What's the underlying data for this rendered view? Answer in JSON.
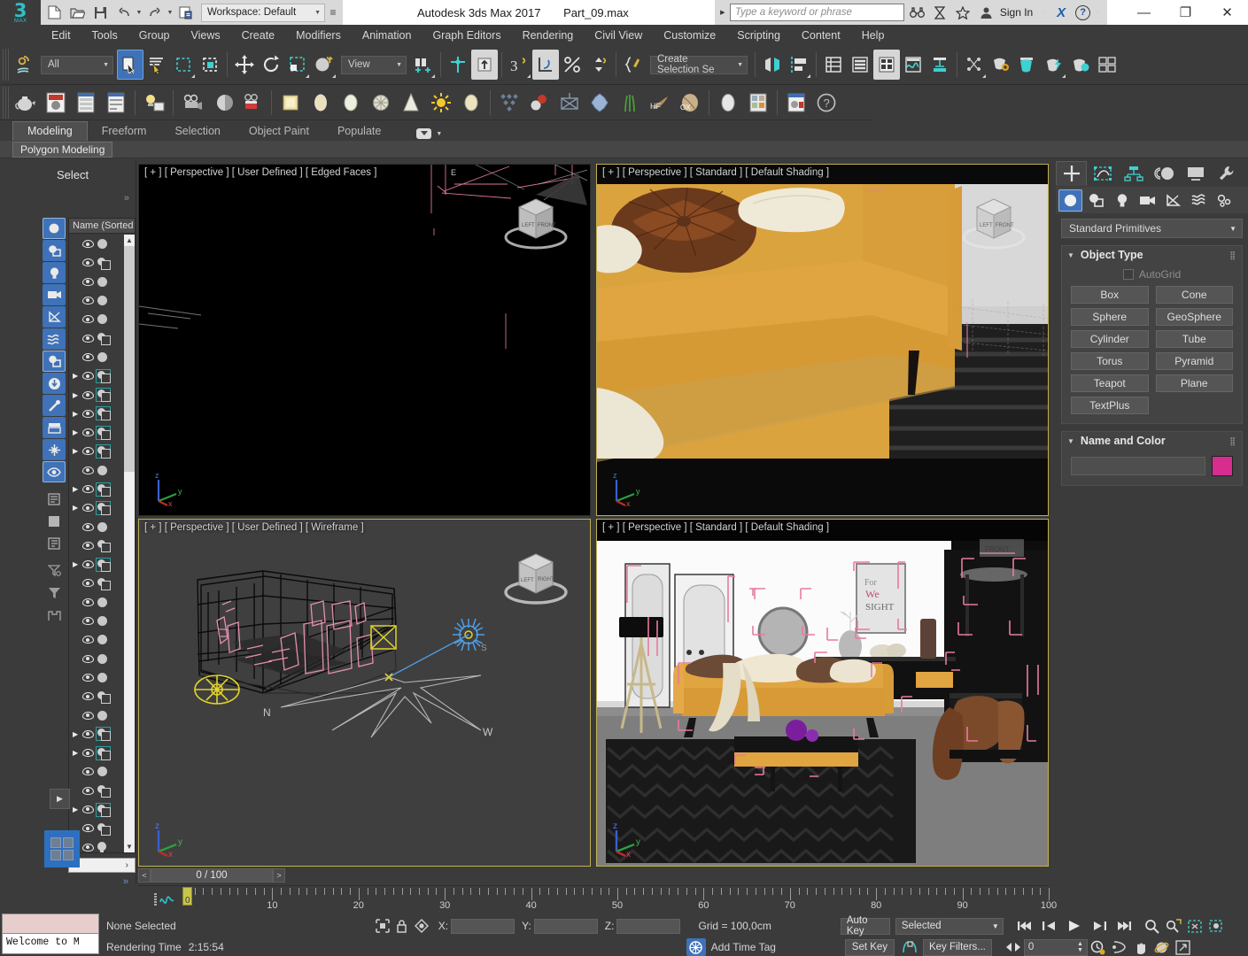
{
  "titlebar": {
    "workspace": "Workspace: Default",
    "app_title": "Autodesk 3ds Max 2017",
    "file_name": "Part_09.max",
    "search_placeholder": "Type a keyword or phrase",
    "sign_in": "Sign In",
    "x_logo": "X",
    "help_glyph": "?",
    "minimize": "—",
    "maximize": "❐",
    "close": "✕",
    "logo_number": "3",
    "logo_sub": "MAX"
  },
  "menubar": {
    "items": [
      "Edit",
      "Tools",
      "Group",
      "Views",
      "Create",
      "Modifiers",
      "Animation",
      "Graph Editors",
      "Rendering",
      "Civil View",
      "Customize",
      "Scripting",
      "Content",
      "Help"
    ]
  },
  "toolbar": {
    "filter_value": "All",
    "reference_coord": "View",
    "selection_set": "Create Selection Se"
  },
  "ribbon": {
    "tabs": [
      "Modeling",
      "Freeform",
      "Selection",
      "Object Paint",
      "Populate"
    ],
    "active_tab": "Modeling",
    "panel_label": "Polygon Modeling"
  },
  "explorer": {
    "title": "Select",
    "column_header": "Name (Sorted",
    "expand_chevron": "»",
    "prev": "‹",
    "next": "›",
    "rows": [
      {
        "tri": false,
        "icon": "dot"
      },
      {
        "tri": false,
        "icon": "geo"
      },
      {
        "tri": false,
        "icon": "dot"
      },
      {
        "tri": false,
        "icon": "dot"
      },
      {
        "tri": false,
        "icon": "dot"
      },
      {
        "tri": false,
        "icon": "geo"
      },
      {
        "tri": false,
        "icon": "dot"
      },
      {
        "tri": true,
        "icon": "geo-sel"
      },
      {
        "tri": true,
        "icon": "geo-sel"
      },
      {
        "tri": true,
        "icon": "geo-sel"
      },
      {
        "tri": true,
        "icon": "geo-sel"
      },
      {
        "tri": true,
        "icon": "geo-sel"
      },
      {
        "tri": false,
        "icon": "dot"
      },
      {
        "tri": true,
        "icon": "geo-sel"
      },
      {
        "tri": true,
        "icon": "geo-sel"
      },
      {
        "tri": false,
        "icon": "dot"
      },
      {
        "tri": false,
        "icon": "geo"
      },
      {
        "tri": true,
        "icon": "geo-sel"
      },
      {
        "tri": false,
        "icon": "geo"
      },
      {
        "tri": false,
        "icon": "dot"
      },
      {
        "tri": false,
        "icon": "dot"
      },
      {
        "tri": false,
        "icon": "dot"
      },
      {
        "tri": false,
        "icon": "dot"
      },
      {
        "tri": false,
        "icon": "dot"
      },
      {
        "tri": false,
        "icon": "geo"
      },
      {
        "tri": false,
        "icon": "dot"
      },
      {
        "tri": true,
        "icon": "geo-sel"
      },
      {
        "tri": true,
        "icon": "geo-sel"
      },
      {
        "tri": false,
        "icon": "dot"
      },
      {
        "tri": false,
        "icon": "geo"
      },
      {
        "tri": true,
        "icon": "geo-sel"
      },
      {
        "tri": false,
        "icon": "geo"
      },
      {
        "tri": false,
        "icon": "bulb"
      },
      {
        "tri": false,
        "icon": "bulb"
      },
      {
        "tri": false,
        "icon": "dot"
      }
    ]
  },
  "viewports": {
    "top_left": "[ + ] [ Perspective ] [ User Defined ] [ Edged Faces ]",
    "top_right": "[ + ] [ Perspective ] [ Standard ] [ Default Shading ]",
    "bottom_left": "[ + ] [ Perspective ] [ User Defined ] [ Wireframe ]",
    "bottom_right": "[ + ] [ Perspective ] [ Standard ] [ Default Shading ]",
    "compass_n": "N",
    "compass_w": "W",
    "viewcube_front": "FRONT",
    "viewcube_right": "RIGHT",
    "axis_x": "x",
    "axis_y": "y",
    "axis_z": "z"
  },
  "command_panel": {
    "category": "Standard Primitives",
    "object_type_title": "Object Type",
    "autogrid_label": "AutoGrid",
    "buttons": [
      "Box",
      "Cone",
      "Sphere",
      "GeoSphere",
      "Cylinder",
      "Tube",
      "Torus",
      "Pyramid",
      "Teapot",
      "Plane",
      "TextPlus"
    ],
    "name_color_title": "Name and Color",
    "name_value": "",
    "color_swatch": "#d62d8f"
  },
  "timeline": {
    "current_frame_display": "0 / 100",
    "prev_glyph": "<",
    "next_glyph": ">",
    "slider_label": "0",
    "tick_labels": [
      "10",
      "20",
      "30",
      "40",
      "50",
      "60",
      "70",
      "80",
      "90",
      "100"
    ],
    "range_start": 0,
    "range_end": 100
  },
  "listener": {
    "text": "Welcome to M"
  },
  "statusbar": {
    "selection_status": "None Selected",
    "rendering_time_label": "Rendering Time",
    "rendering_time_value": "2:15:54",
    "x_label": "X:",
    "x_value": "",
    "y_label": "Y:",
    "y_value": "",
    "z_label": "Z:",
    "z_value": "",
    "grid_label": "Grid = 100,0cm",
    "add_time_tag": "Add Time Tag",
    "auto_key": "Auto Key",
    "set_key": "Set Key",
    "key_mode": "Selected",
    "key_filters": "Key Filters...",
    "frame_spinner": "0"
  }
}
